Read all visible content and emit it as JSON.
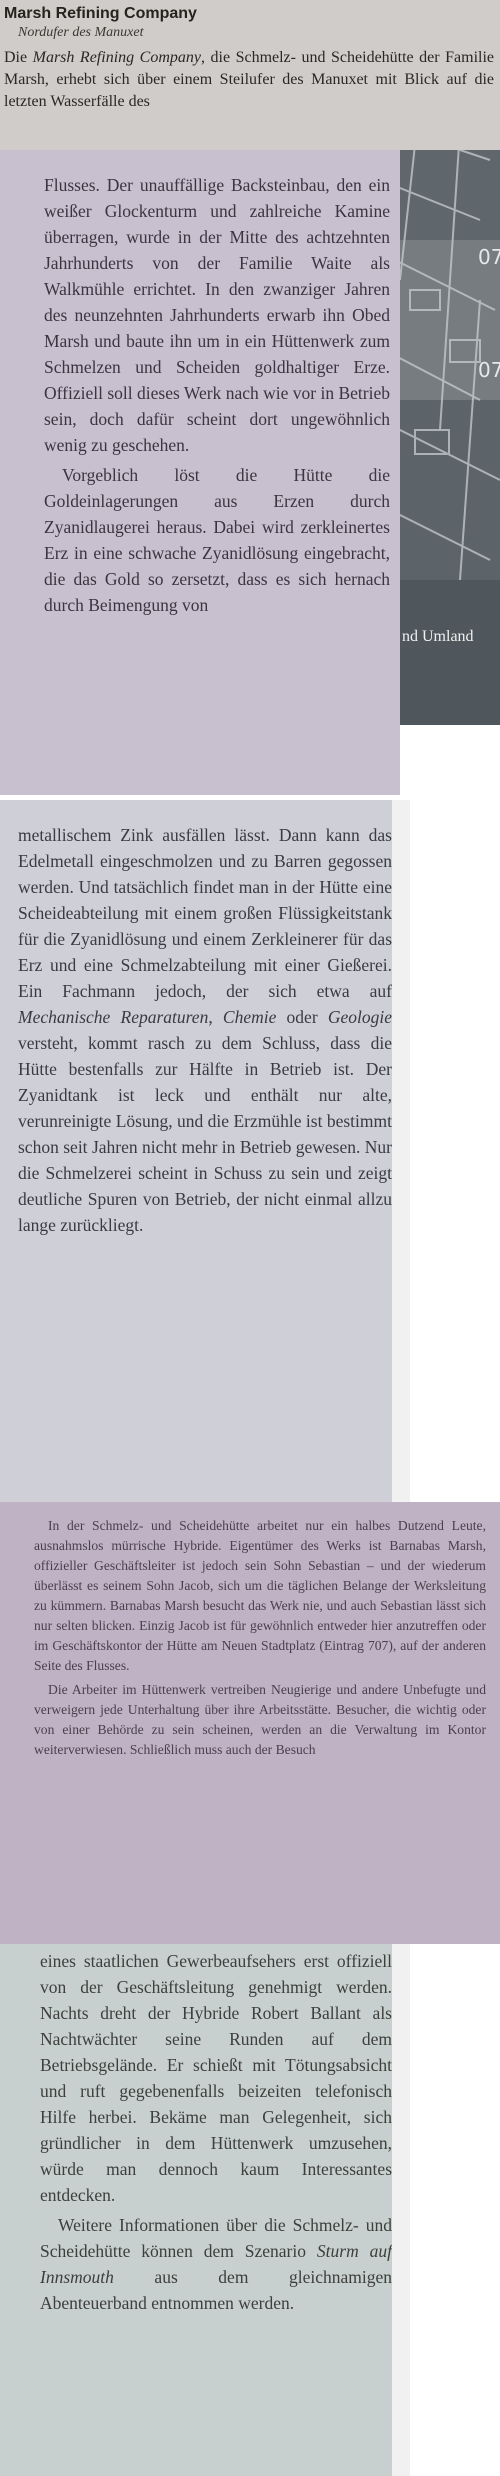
{
  "header": {
    "title": "Marsh Refining Company",
    "subtitle": "Nordufer des Manuxet"
  },
  "sections": {
    "s1": {
      "p1": [
        {
          "t": "Die "
        },
        {
          "t": "Marsh Refining Company",
          "i": true
        },
        {
          "t": ", die Schmelz- und Scheidehütte der Familie Marsh, erhebt sich über einem Steilufer des Manuxet mit Blick auf die letzten Wasserfälle des"
        }
      ]
    },
    "s2": {
      "p1": [
        {
          "t": "Flusses. Der unauffällige Backsteinbau, den ein weißer Glockenturm und zahlreiche Kamine überragen, wurde in der Mitte des achtzehnten Jahrhunderts von der Familie Waite als Walkmühle errichtet. In den zwanziger Jahren des neunzehnten Jahrhunderts erwarb ihn Obed Marsh und baute ihn um in ein Hüttenwerk zum Schmelzen und Scheiden goldhaltiger Erze. Offiziell soll dieses Werk nach wie vor in Betrieb sein, doch dafür scheint dort ungewöhnlich wenig zu geschehen."
        }
      ],
      "p2": [
        {
          "t": "Vorgeblich löst die Hütte die Goldeinlagerungen aus Erzen durch Zyanidlaugerei heraus. Dabei wird zerkleinertes Erz in eine schwache Zyanidlösung eingebracht, die das Gold so zersetzt, dass es sich hernach durch Beimengung von"
        }
      ]
    },
    "s3": {
      "p1": [
        {
          "t": "metallischem Zink ausfällen lässt. Dann kann das Edelmetall eingeschmolzen und zu Barren gegossen werden. Und tatsächlich findet man in der Hütte eine Scheideabteilung mit einem großen Flüssigkeitstank für die Zyanidlösung und einem Zerkleinerer für das Erz und eine Schmelzabteilung mit einer Gießerei. Ein Fachmann jedoch, der sich etwa auf "
        },
        {
          "t": "Mechanische Reparaturen",
          "i": true
        },
        {
          "t": ", "
        },
        {
          "t": "Chemie",
          "i": true
        },
        {
          "t": " oder "
        },
        {
          "t": "Geologie",
          "i": true
        },
        {
          "t": " versteht, kommt rasch zu dem Schluss, dass die Hütte bestenfalls zur Hälfte in Betrieb ist. Der Zyanidtank ist leck und enthält nur alte, verunreinigte Lösung, und die Erzmühle ist bestimmt schon seit Jahren nicht mehr in Betrieb gewesen. Nur die Schmelzerei scheint in Schuss zu sein und zeigt deutliche Spuren von Betrieb, der nicht einmal allzu lange zurückliegt."
        }
      ]
    },
    "s4": {
      "p1": [
        {
          "t": "In der Schmelz- und Scheidehütte arbeitet nur ein halbes Dutzend Leute, ausnahmslos mürrische Hybride. Eigentümer des Werks ist Barnabas Marsh, offizieller Geschäftsleiter ist jedoch sein Sohn Sebastian – und der wiederum überlässt es seinem Sohn Jacob, sich um die täglichen Belange der Werksleitung zu kümmern. Barnabas Marsh besucht das Werk nie, und auch Sebastian lässt sich nur selten blicken. Einzig Jacob ist für gewöhnlich entweder hier anzutreffen oder im Geschäftskontor der Hütte am Neuen Stadtplatz (Eintrag 707), auf der anderen Seite des Flusses."
        }
      ],
      "p2": [
        {
          "t": "Die Arbeiter im Hüttenwerk vertreiben Neugierige und andere Unbefugte und verweigern jede Unterhaltung über ihre Arbeitsstätte. Besucher, die wichtig oder von einer Behörde zu sein scheinen, werden an die Verwaltung im Kontor weiterverwiesen. Schließlich muss auch der Besuch"
        }
      ]
    },
    "s5": {
      "p1": [
        {
          "t": "eines staatlichen Gewerbeaufsehers erst offiziell von der Geschäftsleitung genehmigt werden. Nachts dreht der Hybride Robert Ballant als Nachtwächter seine Runden auf dem Betriebsgelände. Er schießt mit Tötungsabsicht und ruft gegebenenfalls beizeiten telefonisch Hilfe herbei. Bekäme man Gelegenheit, sich gründlicher in dem Hüttenwerk umzusehen, würde man dennoch kaum Interessantes entdecken."
        }
      ],
      "p2": [
        {
          "t": "Weitere Informationen über die Schmelz- und Scheidehütte können dem Szenario "
        },
        {
          "t": "Sturm auf Innsmouth",
          "i": true
        },
        {
          "t": " aus dem gleichnamigen Abenteuerband entnommen werden."
        }
      ]
    }
  },
  "map": {
    "labels": [
      "07",
      "07",
      "nd Umland"
    ]
  },
  "colors": {
    "sheet1": "#cfccc9",
    "sheet2": "#c8bfcf",
    "sheet3": "#cfd0d7",
    "sheet4": "#bfb2c4",
    "sheet5": "#c8d0cf",
    "map": "#6e7479"
  }
}
